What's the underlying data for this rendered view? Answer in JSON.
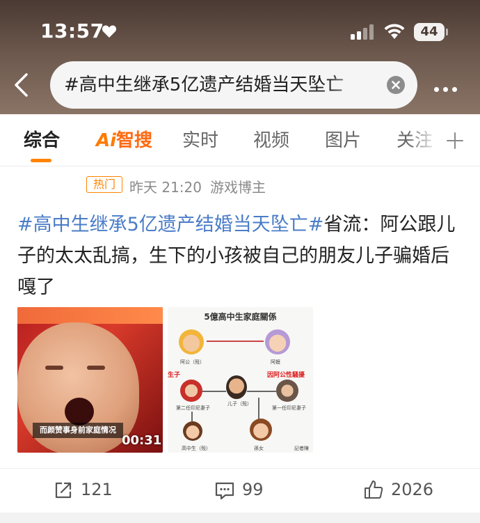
{
  "status_bar": {
    "time": "13:57",
    "battery": "44"
  },
  "search": {
    "query": "#高中生继承5亿遗产结婚当天坠亡"
  },
  "tabs": [
    {
      "label": "综合",
      "active": true
    },
    {
      "label": "智搜",
      "prefix": "Ai"
    },
    {
      "label": "实时"
    },
    {
      "label": "视频"
    },
    {
      "label": "图片"
    },
    {
      "label": "关注"
    }
  ],
  "post": {
    "badge": "热门",
    "time": "昨天 21:20",
    "source": "游戏博主",
    "hashtag": "#高中生继承5亿遗产结婚当天坠亡#",
    "text": "省流：阿公跟儿子的太太乱搞，生下的小孩被自己的朋友儿子骗婚后嘎了",
    "video": {
      "subtitle": "而颜赞事身前家庭情况",
      "duration": "00:31"
    },
    "diagram": {
      "title": "5億高中生家庭關係",
      "labels": {
        "grandpa": "阿公（殁）",
        "grandma": "阿嬷",
        "son": "儿子（殁）",
        "second_wife": "第二任印尼妻子",
        "first_wife": "第一任印尼妻子",
        "student": "高中生（殁）",
        "grandchild": "孫女",
        "red_left": "生子",
        "red_right": "因阿公性騷擾",
        "reporter": "記者陳"
      }
    }
  },
  "actions": {
    "share_count": "121",
    "comment_count": "99",
    "like_count": "2026"
  },
  "colors": {
    "accent": "#ff8200",
    "hashtag": "#4a7cc7",
    "header_dark": "#4a3a33"
  }
}
